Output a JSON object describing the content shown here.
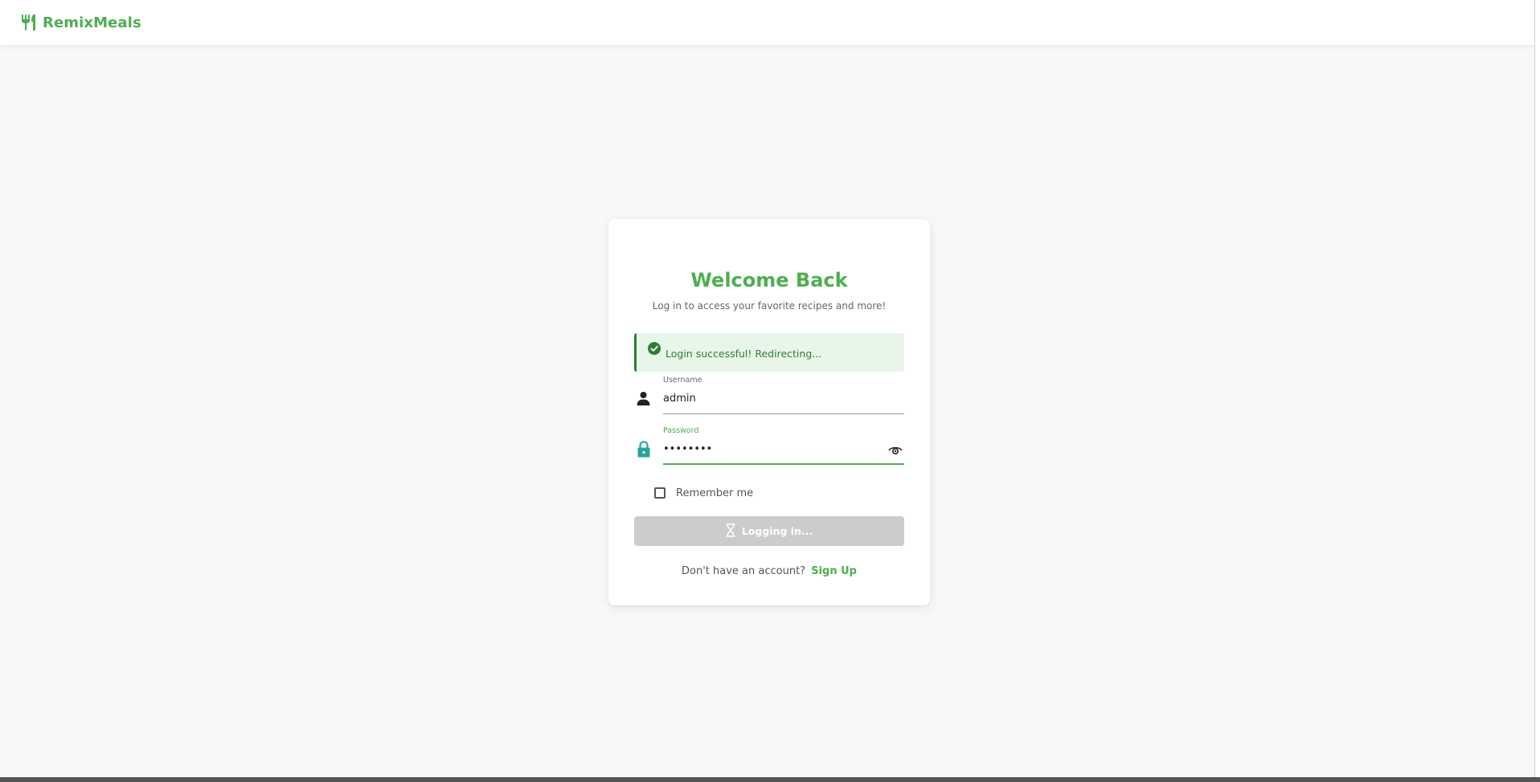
{
  "app": {
    "brand_name": "RemixMeals",
    "brand_icon": "fork-knife-icon",
    "accent_color": "#4caf50"
  },
  "login": {
    "title": "Welcome Back",
    "subtitle": "Log in to access your favorite recipes and more!",
    "alert": {
      "type": "success",
      "icon": "check-circle-icon",
      "message": "Login successful! Redirecting..."
    },
    "username": {
      "label": "Username",
      "value": "admin",
      "icon": "person-icon"
    },
    "password": {
      "label": "Password",
      "value": "••••••••",
      "icon": "lock-icon",
      "toggle_icon": "eye-icon"
    },
    "remember_me": {
      "label": "Remember me",
      "checked": false
    },
    "submit": {
      "label": "Logging in...",
      "icon": "hourglass-icon",
      "disabled": true
    },
    "signup": {
      "prompt": "Don't have an account?",
      "link_label": "Sign Up"
    }
  }
}
